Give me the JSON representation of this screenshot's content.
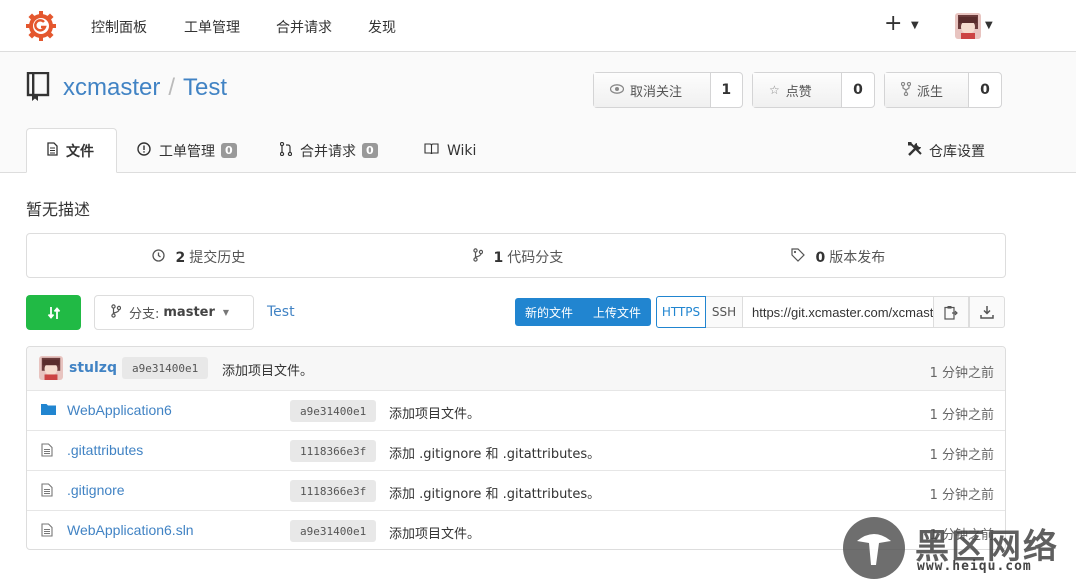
{
  "nav": {
    "items": [
      "控制面板",
      "工单管理",
      "合并请求",
      "发现"
    ],
    "plus": "+"
  },
  "repo": {
    "owner": "xcmaster",
    "separator": "/",
    "name": "Test",
    "watch": {
      "label": "取消关注",
      "count": "1"
    },
    "star": {
      "label": "点赞",
      "count": "0"
    },
    "fork": {
      "label": "派生",
      "count": "0"
    }
  },
  "tabs": {
    "files": "文件",
    "issues": "工单管理",
    "issues_count": "0",
    "pulls": "合并请求",
    "pulls_count": "0",
    "wiki": "Wiki",
    "settings": "仓库设置"
  },
  "description": "暂无描述",
  "stats": {
    "commits_count": "2",
    "commits_label": "提交历史",
    "branches_count": "1",
    "branches_label": "代码分支",
    "releases_count": "0",
    "releases_label": "版本发布"
  },
  "toolbar": {
    "branch_prefix": "分支:",
    "branch": "master",
    "breadcrumb": "Test",
    "new_file": "新的文件",
    "upload_file": "上传文件",
    "https": "HTTPS",
    "ssh": "SSH",
    "clone_url": "https://git.xcmaster.com/xcmaster/Test.git"
  },
  "latest_commit": {
    "author": "stulzq",
    "sha": "a9e31400e1",
    "message": "添加项目文件。",
    "age": "1 分钟之前"
  },
  "files": [
    {
      "name": "WebApplication6",
      "type": "folder",
      "sha": "a9e31400e1",
      "message": "添加项目文件。",
      "age": "1 分钟之前"
    },
    {
      "name": ".gitattributes",
      "type": "file",
      "sha": "1118366e3f",
      "message": "添加 .gitignore 和 .gitattributes。",
      "age": "1 分钟之前"
    },
    {
      "name": ".gitignore",
      "type": "file",
      "sha": "1118366e3f",
      "message": "添加 .gitignore 和 .gitattributes。",
      "age": "1 分钟之前"
    },
    {
      "name": "WebApplication6.sln",
      "type": "file",
      "sha": "a9e31400e1",
      "message": "添加项目文件。",
      "age": "1 分钟之前"
    }
  ],
  "watermark": {
    "text": "黑区网络",
    "url": "www.heiqu.com"
  },
  "colors": {
    "link": "#4183c4",
    "green": "#21ba45",
    "blue": "#2185d0",
    "logo": "#e4572e"
  }
}
